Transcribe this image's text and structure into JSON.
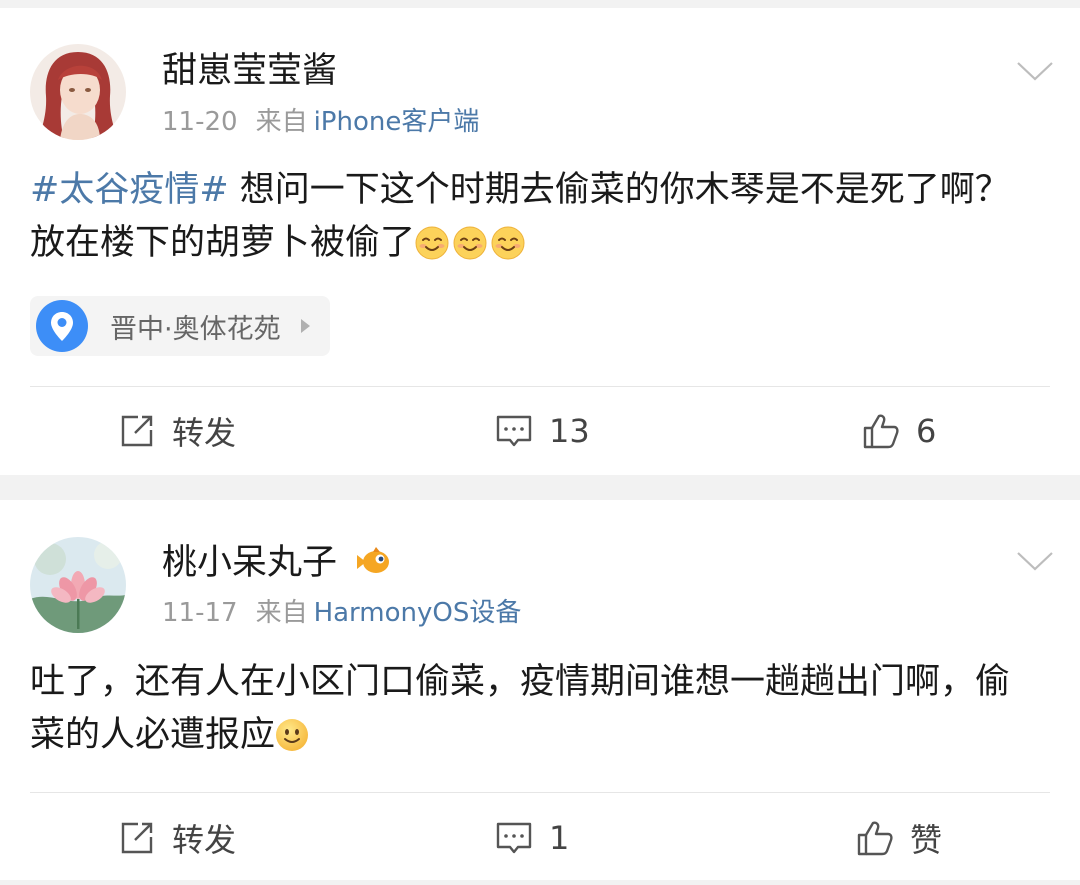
{
  "posts": [
    {
      "username": "甜崽莹莹酱",
      "date": "11-20",
      "from_label": "来自",
      "source": "iPhone客户端",
      "hashtag": "#太谷疫情#",
      "text": " 想问一下这个时期去偷菜的你木琴是不是死了啊？放在楼下的胡萝卜被偷了",
      "emoji_count": 3,
      "emoji_icon": "smiling-face-icon",
      "location": "晋中·奥体花苑",
      "repost_label": "转发",
      "comment_count": "13",
      "like_label": "6"
    },
    {
      "username": "桃小呆丸子",
      "date": "11-17",
      "from_label": "来自",
      "source": "HarmonyOS设备",
      "text": "吐了，还有人在小区门口偷菜，疫情期间谁想一趟趟出门啊，偷菜的人必遭报应",
      "emoji_icon": "slightly-smiling-face-icon",
      "badge_icon": "fish-badge-icon",
      "repost_label": "转发",
      "comment_count": "1",
      "like_label": "赞"
    }
  ],
  "colors": {
    "link_blue": "#4c79a8",
    "meta_gray": "#9a9a9a",
    "background": "#f2f2f2",
    "location_pin": "#3d8ef7"
  }
}
